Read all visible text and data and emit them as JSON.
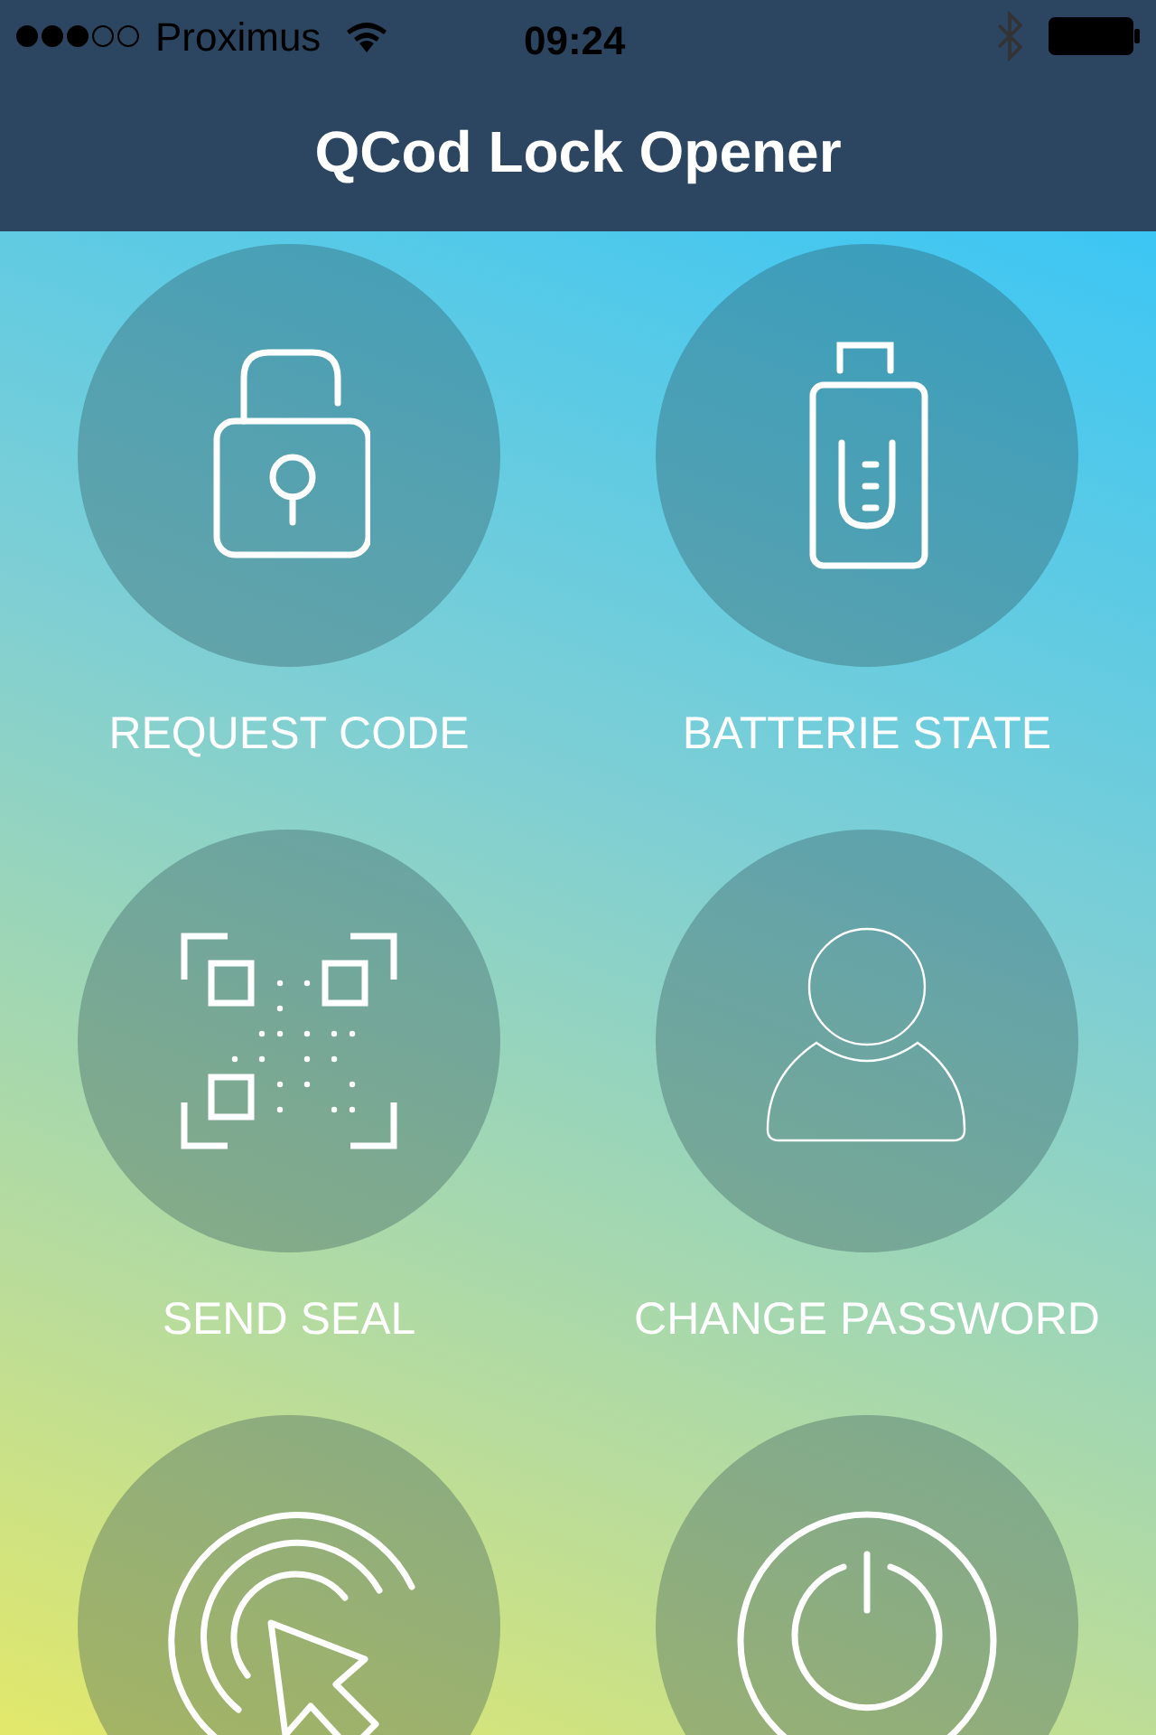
{
  "status_bar": {
    "carrier": "Proximus",
    "time": "09:24"
  },
  "header": {
    "title": "QCod Lock Opener"
  },
  "tiles": [
    {
      "kind": "lock",
      "label": "REQUEST CODE"
    },
    {
      "kind": "battery",
      "label": "BATTERIE STATE"
    },
    {
      "kind": "qr",
      "label": "SEND SEAL"
    },
    {
      "kind": "person",
      "label": "CHANGE PASSWORD"
    },
    {
      "kind": "tap"
    },
    {
      "kind": "power"
    }
  ]
}
